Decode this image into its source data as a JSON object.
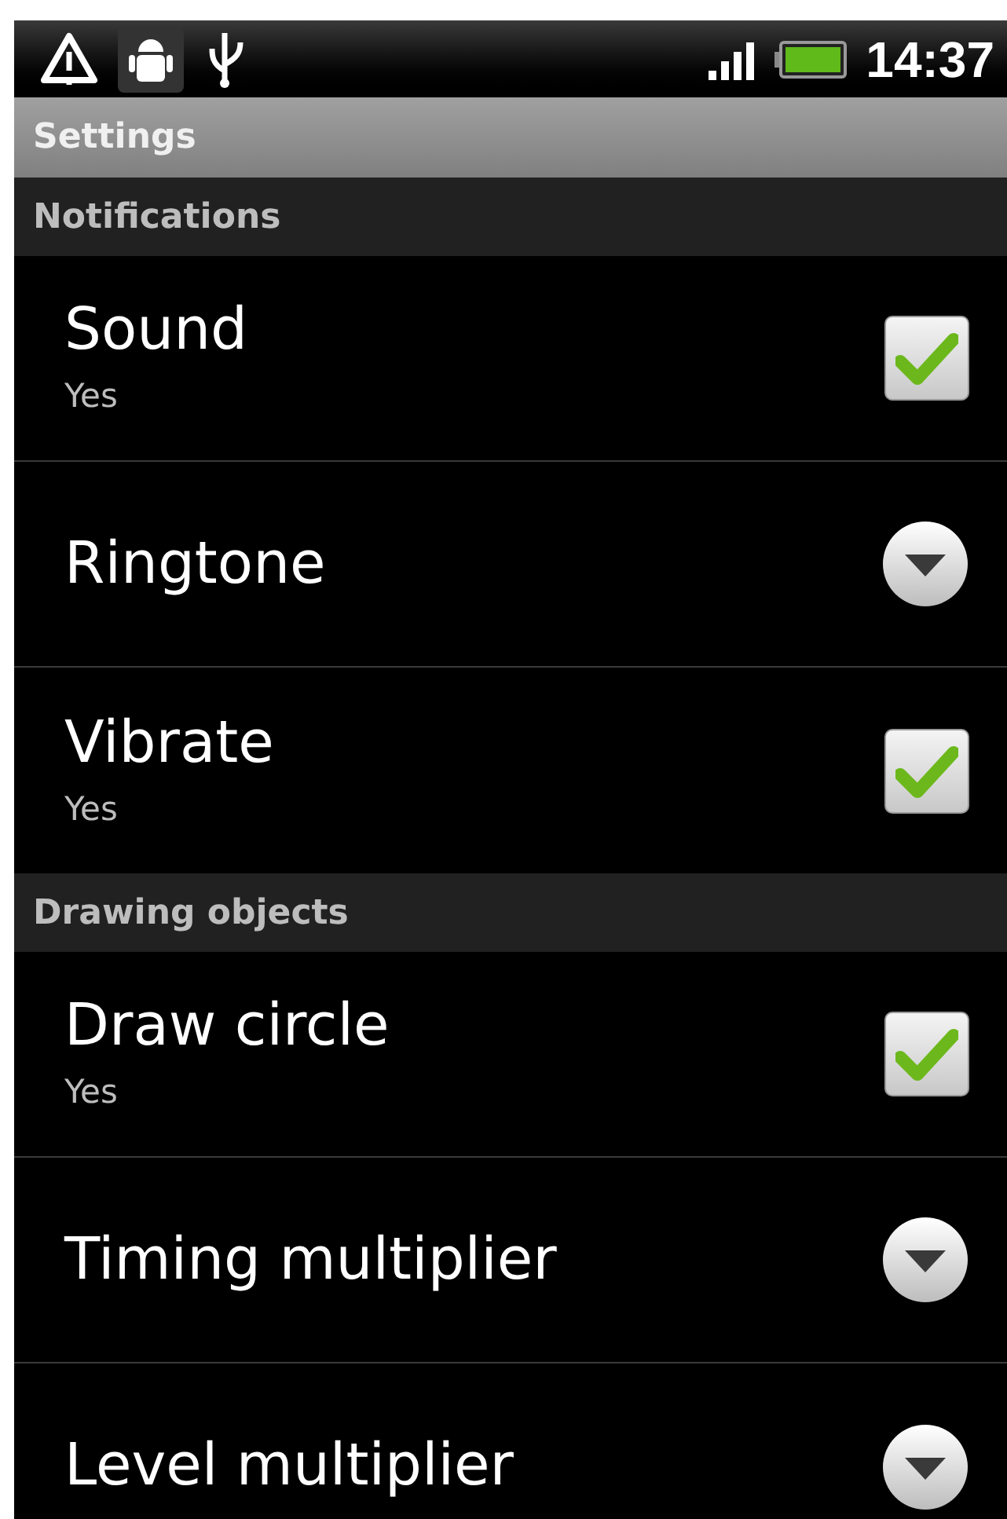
{
  "status_bar": {
    "time": "14:37"
  },
  "title": "Settings",
  "sections": [
    {
      "header": "Notifications",
      "items": [
        {
          "kind": "checkbox",
          "label": "Sound",
          "summary": "Yes",
          "checked": true
        },
        {
          "kind": "list",
          "label": "Ringtone"
        },
        {
          "kind": "checkbox",
          "label": "Vibrate",
          "summary": "Yes",
          "checked": true
        }
      ]
    },
    {
      "header": "Drawing objects",
      "items": [
        {
          "kind": "checkbox",
          "label": "Draw circle",
          "summary": "Yes",
          "checked": true
        },
        {
          "kind": "list",
          "label": "Timing multiplier"
        },
        {
          "kind": "list",
          "label": "Level multiplier"
        }
      ]
    }
  ]
}
